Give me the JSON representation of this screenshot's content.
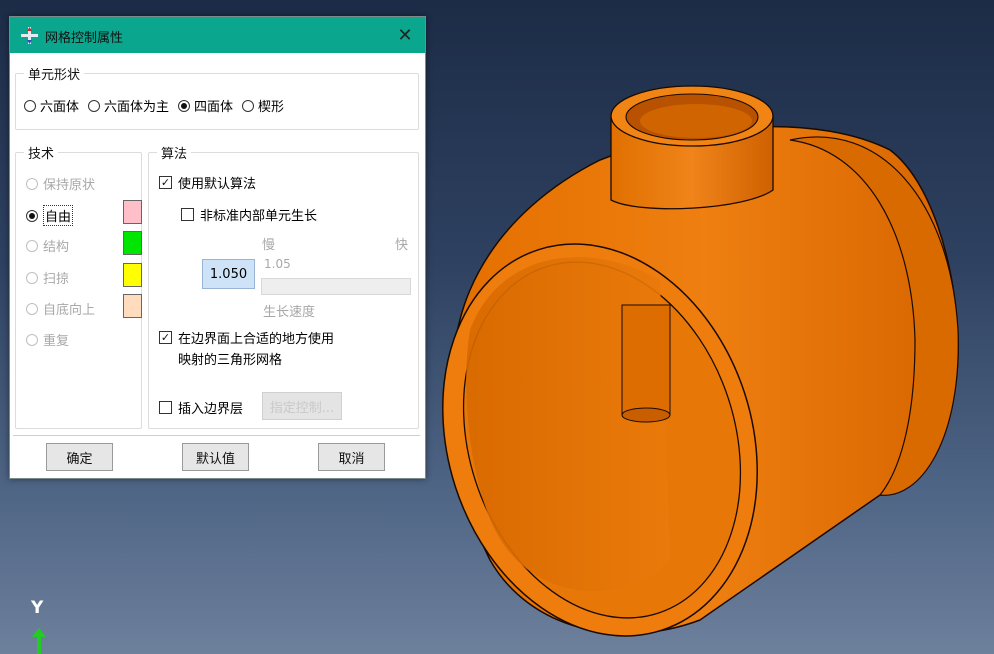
{
  "dialog": {
    "title": "网格控制属性",
    "close_label": "✕",
    "element_shape": {
      "legend": "单元形状",
      "options": [
        "六面体",
        "六面体为主",
        "四面体",
        "楔形"
      ],
      "selected": "四面体"
    },
    "technique": {
      "legend": "技术",
      "items": [
        {
          "label": "保持原状",
          "enabled": false,
          "selected": false
        },
        {
          "label": "自由",
          "enabled": true,
          "selected": true,
          "color": "#ffbfc8"
        },
        {
          "label": "结构",
          "enabled": false,
          "selected": false,
          "color": "#00e600"
        },
        {
          "label": "扫掠",
          "enabled": false,
          "selected": false,
          "color": "#ffff00"
        },
        {
          "label": "自底向上",
          "enabled": false,
          "selected": false,
          "color": "#ffdcbe"
        },
        {
          "label": "重复",
          "enabled": false,
          "selected": false
        }
      ]
    },
    "algorithm": {
      "legend": "算法",
      "use_default_label": "使用默认算法",
      "use_default_checked": true,
      "nonstandard_label": "非标准内部单元生长",
      "nonstandard_checked": false,
      "slow_label": "慢",
      "fast_label": "快",
      "growth_value": "1.050",
      "growth_display": "1.05",
      "growth_rate_label": "生长速度",
      "mapped_label_line1": "在边界面上合适的地方使用",
      "mapped_label_line2": "映射的三角形网格",
      "mapped_checked": true,
      "boundary_layer_label": "插入边界层",
      "boundary_layer_checked": false,
      "specify_controls_label": "指定控制..."
    },
    "buttons": {
      "ok": "确定",
      "defaults": "默认值",
      "cancel": "取消"
    }
  },
  "viewport": {
    "axis_label": "Y",
    "part_color": "#e8780c",
    "background_top": "#1c2c47",
    "background_bottom": "#6d809c"
  }
}
